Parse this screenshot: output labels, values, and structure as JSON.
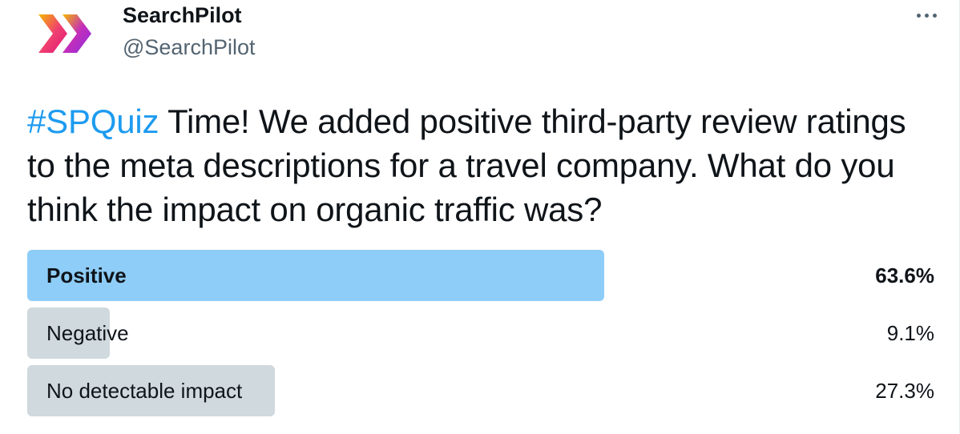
{
  "account": {
    "name": "SearchPilot",
    "handle": "@SearchPilot"
  },
  "tweet": {
    "hashtag": "#SPQuiz",
    "text": " Time! We added positive third-party review ratings to the meta descriptions for a travel company. What do you think the impact on organic traffic was?"
  },
  "poll": {
    "options": [
      {
        "label": "Positive",
        "percent_text": "63.6%",
        "percent": 63.6,
        "winner": true
      },
      {
        "label": "Negative",
        "percent_text": "9.1%",
        "percent": 9.1,
        "winner": false
      },
      {
        "label": "No detectable impact",
        "percent_text": "27.3%",
        "percent": 27.3,
        "winner": false
      }
    ]
  },
  "icons": {
    "avatar": "searchpilot-logo-icon",
    "more": "more-options-icon"
  },
  "colors": {
    "hashtag": "#1d9bf0",
    "winner_bar": "#8ecdf7",
    "other_bar": "#cfd9de",
    "logo_pink": "#e0157d",
    "logo_yellow": "#f5b800",
    "logo_purple": "#8a2be2"
  }
}
